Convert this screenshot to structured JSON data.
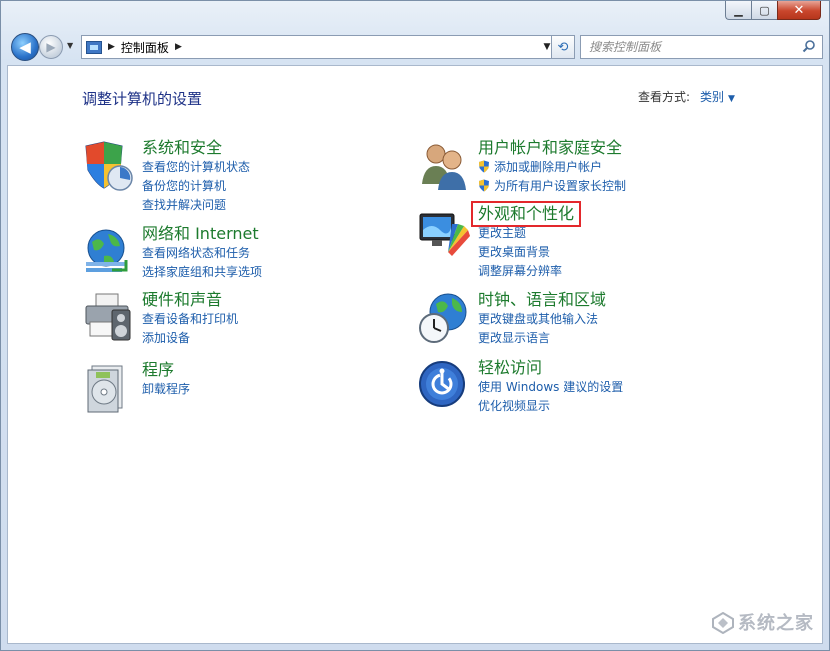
{
  "window": {
    "minimize_icon": "minimize-icon",
    "maximize_icon": "maximize-icon",
    "close_icon": "close-icon"
  },
  "nav": {
    "back_icon": "back-arrow-icon",
    "forward_icon": "forward-arrow-icon",
    "address_crumb": "控制面板",
    "search_placeholder": "搜索控制面板"
  },
  "header": {
    "title": "调整计算机的设置",
    "view_by_label": "查看方式:",
    "view_by_value": "类别"
  },
  "categories": [
    {
      "title": "系统和安全",
      "icon": "system-security-icon",
      "links": [
        "查看您的计算机状态",
        "备份您的计算机",
        "查找并解决问题"
      ]
    },
    {
      "title": "网络和 Internet",
      "icon": "network-internet-icon",
      "links": [
        "查看网络状态和任务",
        "选择家庭组和共享选项"
      ]
    },
    {
      "title": "硬件和声音",
      "icon": "hardware-sound-icon",
      "links": [
        "查看设备和打印机",
        "添加设备"
      ]
    },
    {
      "title": "程序",
      "icon": "programs-icon",
      "links": [
        "卸载程序"
      ]
    },
    {
      "title": "用户帐户和家庭安全",
      "icon": "user-accounts-icon",
      "links": [
        "添加或删除用户帐户",
        "为所有用户设置家长控制"
      ]
    },
    {
      "title": "外观和个性化",
      "icon": "appearance-icon",
      "links": [
        "更改主题",
        "更改桌面背景",
        "调整屏幕分辨率"
      ]
    },
    {
      "title": "时钟、语言和区域",
      "icon": "clock-region-icon",
      "links": [
        "更改键盘或其他输入法",
        "更改显示语言"
      ]
    },
    {
      "title": "轻松访问",
      "icon": "ease-of-access-icon",
      "links": [
        "使用 Windows 建议的设置",
        "优化视频显示"
      ]
    }
  ],
  "watermark": "系统之家",
  "colors": {
    "title_green": "#1c7a2d",
    "link_blue": "#1e5eab",
    "highlight_red": "#e3282c"
  }
}
